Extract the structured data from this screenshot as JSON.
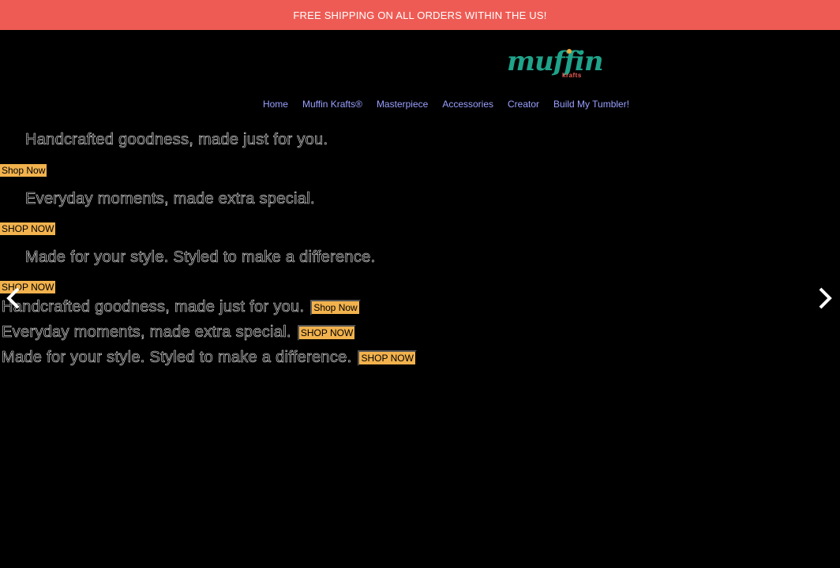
{
  "announcement": "FREE SHIPPING ON ALL ORDERS WITHIN THE US!",
  "logo": {
    "main": "muffin",
    "sub": "krafts"
  },
  "nav": [
    "Home",
    "Muffin Krafts®",
    "Masterpiece",
    "Accessories",
    "Creator",
    "Build My Tumbler!"
  ],
  "slides": [
    {
      "headline": "Handcrafted goodness, made just for you.",
      "button": "Shop Now"
    },
    {
      "headline": "Everyday moments, made extra special.",
      "button": "SHOP NOW"
    },
    {
      "headline": "Made for your style. Styled to make a difference.",
      "button": "SHOP NOW"
    }
  ],
  "icons": {
    "prev": "chevron-left-icon",
    "next": "chevron-right-icon"
  },
  "colors": {
    "announcement_bg": "#ee5b54",
    "logo": "#1fa38a",
    "nav_link": "#9aa0ff",
    "button_bg": "#f2b24d"
  }
}
